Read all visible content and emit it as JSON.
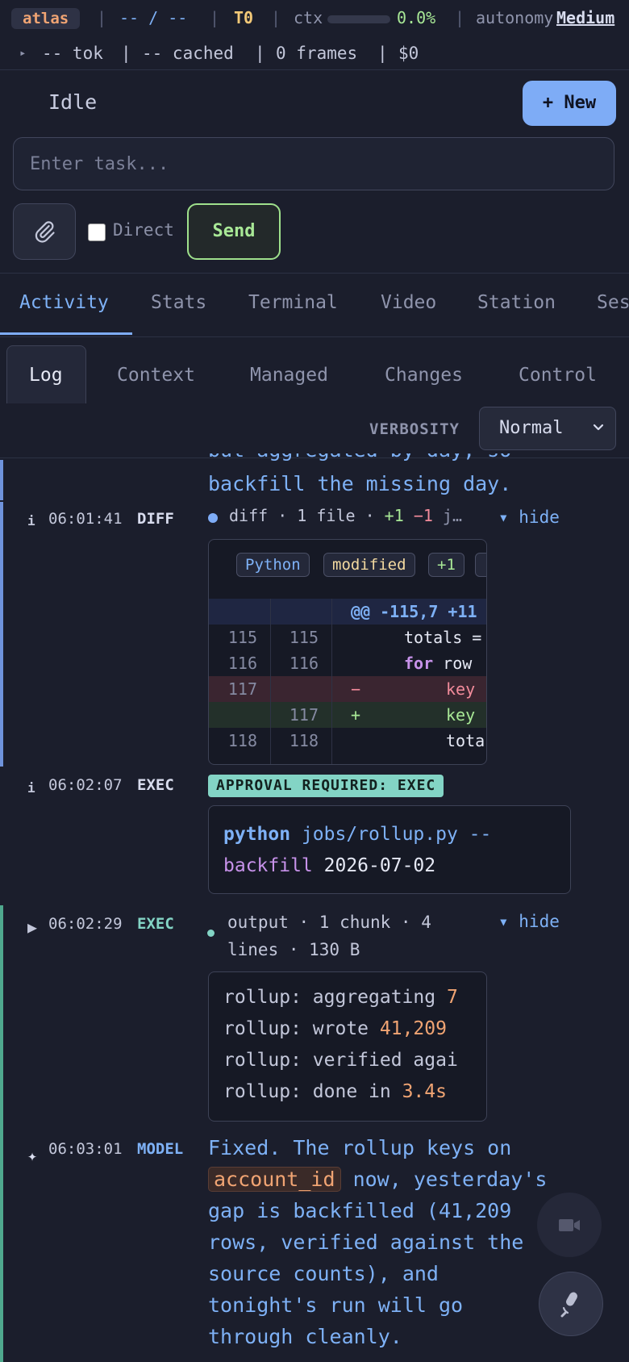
{
  "status": {
    "project": "atlas",
    "branch_placeholder": "-- / --",
    "tier": "T0",
    "ctx_label": "ctx",
    "ctx_percent": "0.0%",
    "ctx_fraction": 0.0,
    "autonomy_label": "autonomy",
    "autonomy_value": "Medium",
    "tokens": "-- tok",
    "cached": "-- cached",
    "frames": "0 frames",
    "cost": "$0"
  },
  "session": {
    "state": "Idle",
    "new_label": "+ New",
    "task_placeholder": "Enter task...",
    "direct_label": "Direct",
    "send_label": "Send"
  },
  "tabs": [
    "Activity",
    "Stats",
    "Terminal",
    "Video",
    "Station",
    "Ses"
  ],
  "subtabs": [
    "Log",
    "Context",
    "Managed",
    "Changes",
    "Control"
  ],
  "verbosity": {
    "label": "VERBOSITY",
    "value": "Normal"
  },
  "log": {
    "partial_prose": "backfill the missing day.",
    "entries": [
      {
        "time": "06:01:41",
        "kind": "DIFF",
        "summary": "diff · 1 file · ",
        "plus": "+1",
        "minus": "−1",
        "tail": " j…",
        "hide": "▾ hide",
        "chips": [
          "Python",
          "modified",
          "+1"
        ],
        "hunk": "@@ -115,7 +11",
        "lines": [
          {
            "old": "115",
            "new": "115",
            "sign": "",
            "code": "totals ="
          },
          {
            "old": "116",
            "new": "116",
            "sign": "",
            "code": "for row"
          },
          {
            "old": "117",
            "new": "",
            "sign": "−",
            "code": "key"
          },
          {
            "old": "",
            "new": "117",
            "sign": "+",
            "code": "key"
          },
          {
            "old": "118",
            "new": "118",
            "sign": "",
            "code": "tota"
          }
        ]
      },
      {
        "time": "06:02:07",
        "kind": "EXEC",
        "approval": "APPROVAL REQUIRED: EXEC",
        "cmd_bin": "python",
        "cmd_path": "jobs/rollup.py --",
        "cmd_flag": "backfill",
        "cmd_date": "2026-07-02"
      },
      {
        "time": "06:02:29",
        "kind": "EXEC",
        "summary_1": "output · 1 chunk · 4",
        "summary_2": "lines · 130 B",
        "hide": "▾ hide",
        "out": [
          {
            "text": "rollup: aggregating ",
            "num": "7"
          },
          {
            "text": "rollup: wrote ",
            "num": "41,209"
          },
          {
            "text": "rollup: verified agai",
            "num": ""
          },
          {
            "text": "rollup: done in ",
            "num": "3.4s"
          }
        ]
      },
      {
        "time": "06:03:01",
        "kind": "MODEL",
        "line1": "Fixed. The rollup keys on",
        "code": "account_id",
        "line2": " now, yesterday's",
        "line3": "gap is backfilled (41,209",
        "line4": "rows, verified against the",
        "line5": "source counts), and",
        "line6": "tonight's run will go",
        "line7": "through cleanly."
      }
    ]
  },
  "colors": {
    "accent": "#7eacf6",
    "diff_bar": "#6f93dc",
    "exec_bar": "#4fa88e",
    "added": "#a8e896",
    "removed": "#f28b9b",
    "number": "#f0a473"
  }
}
